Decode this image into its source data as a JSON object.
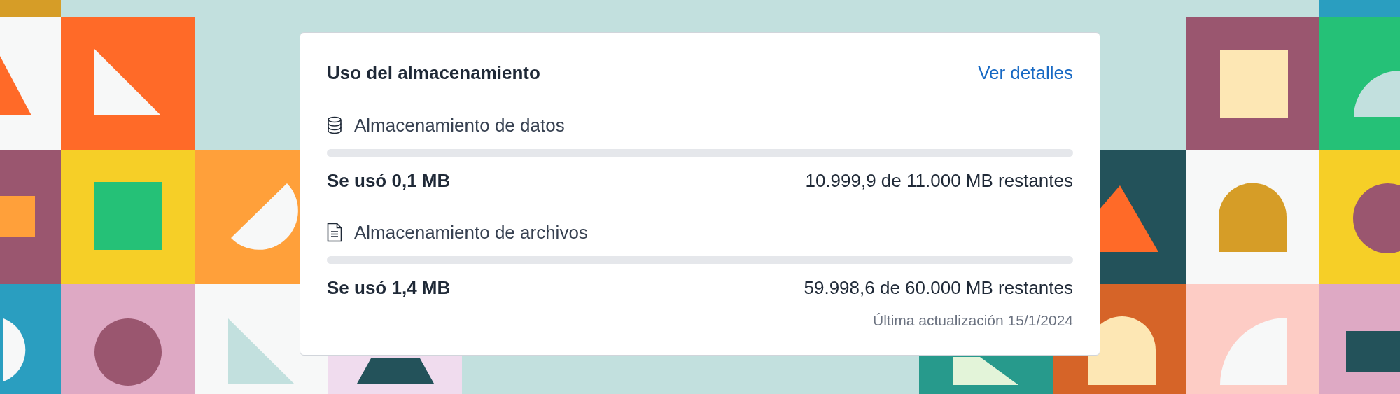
{
  "card": {
    "title": "Uso del almacenamiento",
    "link": "Ver detalles",
    "sections": [
      {
        "kind": "database",
        "label": "Almacenamiento de datos",
        "level": 1e-05,
        "used": "Se usó 0,1 MB",
        "remaining": "10.999,9 de 11.000 MB restantes"
      },
      {
        "kind": "file",
        "label": "Almacenamiento de archivos",
        "level": 2e-05,
        "used": "Se usó 1,4 MB",
        "remaining": "59.998,6 de 60.000 MB restantes"
      }
    ],
    "updated": "Última actualización 15/1/2024"
  }
}
